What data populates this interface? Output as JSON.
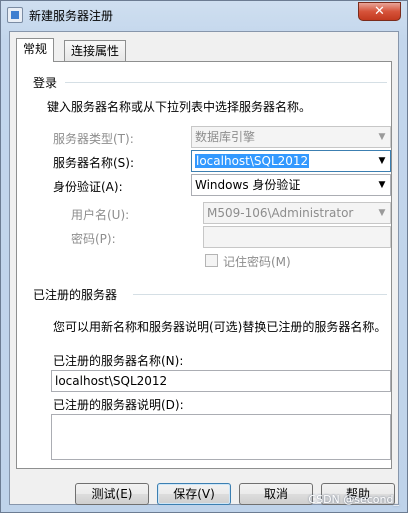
{
  "window": {
    "title": "新建服务器注册",
    "close_glyph": "✕"
  },
  "tabs": [
    {
      "label": "常规"
    },
    {
      "label": "连接属性"
    }
  ],
  "login": {
    "group_label": "登录",
    "description": "键入服务器名称或从下拉列表中选择服务器名称。",
    "server_type": {
      "label": "服务器类型(T):",
      "value": "数据库引擎"
    },
    "server_name": {
      "label": "服务器名称(S):",
      "value": "localhost\\SQL2012"
    },
    "auth": {
      "label": "身份验证(A):",
      "value": "Windows 身份验证"
    },
    "username": {
      "label": "用户名(U):",
      "value": "M509-106\\Administrator"
    },
    "password": {
      "label": "密码(P):",
      "value": ""
    },
    "remember": {
      "label": "记住密码(M)",
      "checked": false
    }
  },
  "registered": {
    "group_label": "已注册的服务器",
    "description": "您可以用新名称和服务器说明(可选)替换已注册的服务器名称。",
    "name": {
      "label": "已注册的服务器名称(N):",
      "value": "localhost\\SQL2012"
    },
    "desc": {
      "label": "已注册的服务器说明(D):",
      "value": ""
    }
  },
  "buttons": {
    "test": "测试(E)",
    "save": "保存(V)",
    "cancel": "取消",
    "help": "帮助"
  },
  "watermark": "CSDN @second_"
}
